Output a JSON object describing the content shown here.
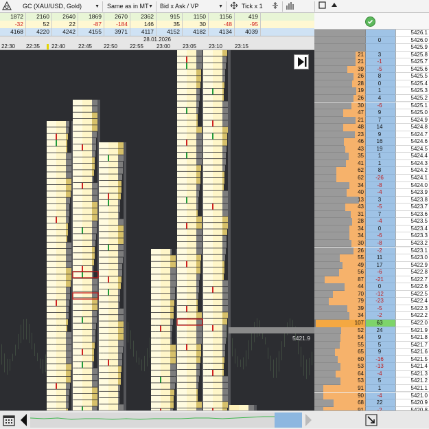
{
  "toolbar": {
    "symbol": "GC (XAU/USD, Gold)",
    "timezone": "Same as in MT",
    "mode": "Bid x Ask / VP",
    "tick": "Tick x 1"
  },
  "summary_rows": [
    [
      "1872",
      "2160",
      "2640",
      "1869",
      "2670",
      "2362",
      "915",
      "1150",
      "1156",
      "419"
    ],
    [
      "-32",
      "52",
      "22",
      "-87",
      "-184",
      "146",
      "35",
      "30",
      "-48",
      "-95"
    ],
    [
      "4168",
      "4220",
      "4242",
      "4155",
      "3971",
      "4117",
      "4152",
      "4182",
      "4134",
      "4039"
    ]
  ],
  "date_label": "28.01.2026",
  "time_labels": [
    "22:30",
    "22:35",
    "22:40",
    "22:45",
    "22:50",
    "22:55",
    "23:00",
    "23:05",
    "23:10",
    "23:15"
  ],
  "current_price_label": "5421.9",
  "colors": {
    "accent_blue": "#9fc3e6",
    "volume_orange": "#f6b26b",
    "delta_green": "#7ed46a",
    "current_price": "#f4a842",
    "chart_bg": "#2c2d31"
  },
  "dom_rows": [
    [
      "",
      "",
      "5426.1"
    ],
    [
      "",
      "0",
      "5426.0"
    ],
    [
      "",
      "",
      "5425.9"
    ],
    [
      "21",
      "3",
      "5425.8"
    ],
    [
      "21",
      "-1",
      "5425.7"
    ],
    [
      "39",
      "-5",
      "5425.6"
    ],
    [
      "26",
      "8",
      "5425.5"
    ],
    [
      "28",
      "0",
      "5425.4"
    ],
    [
      "19",
      "1",
      "5425.3"
    ],
    [
      "26",
      "4",
      "5425.2"
    ],
    [
      "30",
      "-6",
      "5425.1"
    ],
    [
      "47",
      "9",
      "5425.0"
    ],
    [
      "21",
      "7",
      "5424.9"
    ],
    [
      "48",
      "14",
      "5424.8"
    ],
    [
      "23",
      "9",
      "5424.7"
    ],
    [
      "46",
      "16",
      "5424.6"
    ],
    [
      "43",
      "19",
      "5424.5"
    ],
    [
      "35",
      "1",
      "5424.4"
    ],
    [
      "41",
      "1",
      "5424.3"
    ],
    [
      "62",
      "8",
      "5424.2"
    ],
    [
      "62",
      "-26",
      "5424.1"
    ],
    [
      "34",
      "-8",
      "5424.0"
    ],
    [
      "40",
      "-4",
      "5423.9"
    ],
    [
      "13",
      "3",
      "5423.8"
    ],
    [
      "43",
      "-5",
      "5423.7"
    ],
    [
      "31",
      "7",
      "5423.6"
    ],
    [
      "28",
      "-4",
      "5423.5"
    ],
    [
      "34",
      "0",
      "5423.4"
    ],
    [
      "34",
      "-6",
      "5423.3"
    ],
    [
      "30",
      "-8",
      "5423.2"
    ],
    [
      "26",
      "-2",
      "5423.1"
    ],
    [
      "55",
      "11",
      "5423.0"
    ],
    [
      "49",
      "17",
      "5422.9"
    ],
    [
      "56",
      "-6",
      "5422.8"
    ],
    [
      "87",
      "-21",
      "5422.7"
    ],
    [
      "44",
      "0",
      "5422.6"
    ],
    [
      "70",
      "-12",
      "5422.5"
    ],
    [
      "79",
      "-23",
      "5422.4"
    ],
    [
      "39",
      "-5",
      "5422.3"
    ],
    [
      "34",
      "-2",
      "5422.2"
    ],
    [
      "107",
      "63",
      "5422.0"
    ],
    [
      "52",
      "24",
      "5421.9"
    ],
    [
      "54",
      "9",
      "5421.8"
    ],
    [
      "55",
      "5",
      "5421.7"
    ],
    [
      "65",
      "9",
      "5421.6"
    ],
    [
      "60",
      "-16",
      "5421.5"
    ],
    [
      "53",
      "-13",
      "5421.4"
    ],
    [
      "64",
      "-4",
      "5421.3"
    ],
    [
      "53",
      "5",
      "5421.2"
    ],
    [
      "91",
      "1",
      "5421.1"
    ],
    [
      "90",
      "-4",
      "5421.0"
    ],
    [
      "68",
      "22",
      "5420.9"
    ],
    [
      "91",
      "-2",
      "5420.8"
    ]
  ]
}
